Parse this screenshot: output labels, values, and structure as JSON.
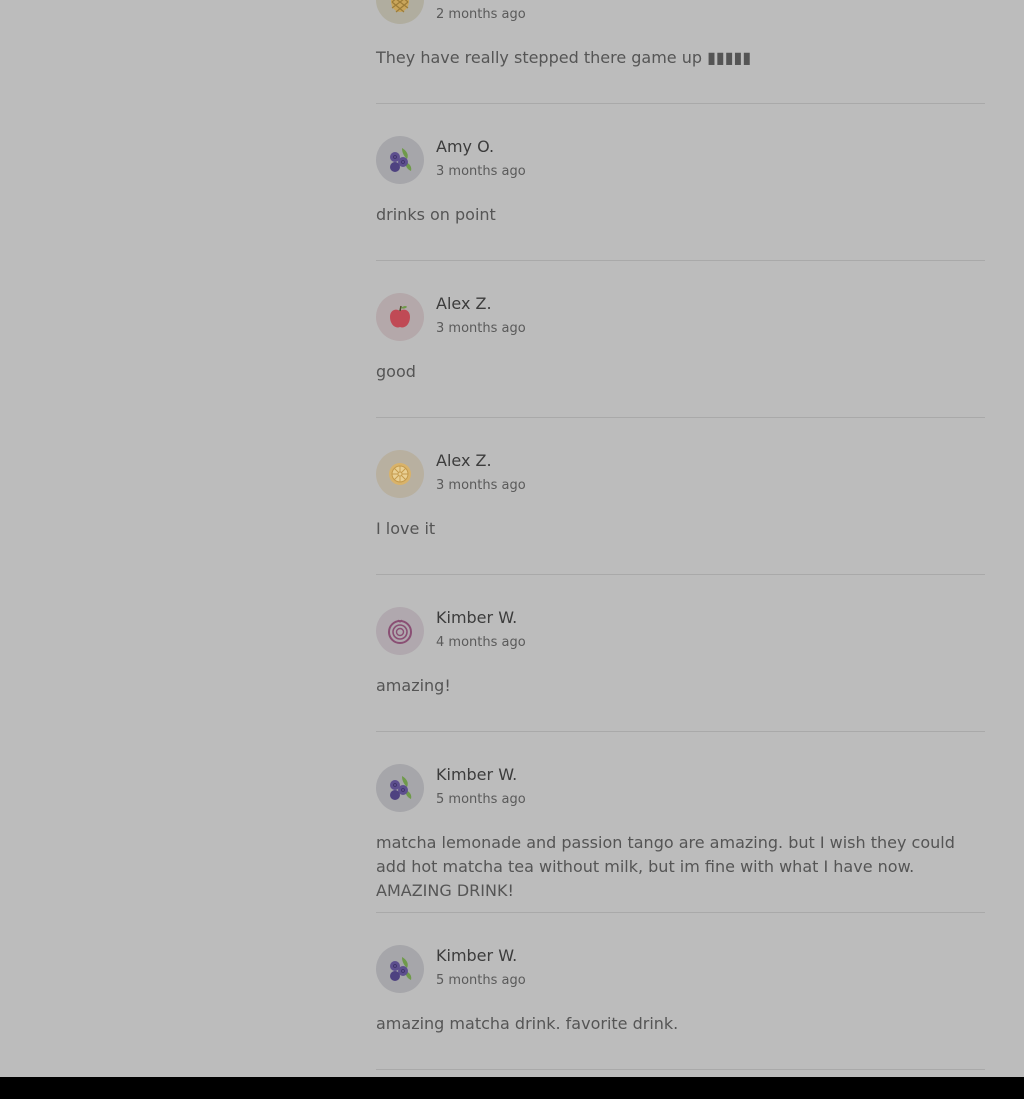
{
  "reviews": [
    {
      "name": "",
      "time": "2 months ago",
      "text": "They have really stepped there game up ▮▮▮▮▮",
      "avatar": "pineapple-icon"
    },
    {
      "name": "Amy O.",
      "time": "3 months ago",
      "text": "drinks on point",
      "avatar": "blueberry-icon"
    },
    {
      "name": "Alex Z.",
      "time": "3 months ago",
      "text": "good",
      "avatar": "apple-icon"
    },
    {
      "name": "Alex Z.",
      "time": "3 months ago",
      "text": "I love it",
      "avatar": "lemon-icon"
    },
    {
      "name": "Kimber W.",
      "time": "4 months ago",
      "text": "amazing!",
      "avatar": "onion-icon"
    },
    {
      "name": "Kimber W.",
      "time": "5 months ago",
      "text": "matcha lemonade and passion tango are amazing. but I wish they could add hot matcha tea without milk, but im fine with what I have now. AMAZING DRINK!",
      "avatar": "blueberry-icon"
    },
    {
      "name": "Kimber W.",
      "time": "5 months ago",
      "text": "amazing matcha drink. favorite drink.",
      "avatar": "blueberry-icon"
    }
  ],
  "colors": {
    "page_background": "#bcbcbc",
    "avatar_background": "#a6a6aa",
    "divider": "#a9a9a9",
    "bottom_bar": "#000000"
  }
}
